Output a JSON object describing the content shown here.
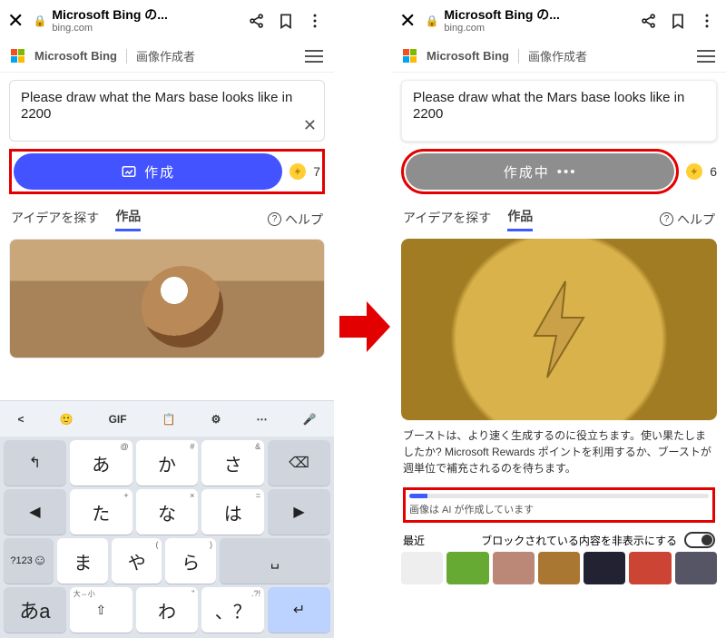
{
  "browser": {
    "title": "Microsoft Bing の...",
    "domain": "bing.com"
  },
  "bing": {
    "brand": "Microsoft Bing",
    "subtitle": "画像作成者"
  },
  "prompt": {
    "text": "Please draw what the Mars base looks like in 2200"
  },
  "tabs": {
    "explore": "アイデアを探す",
    "works": "作品",
    "help": "ヘルプ"
  },
  "left": {
    "create_label": "作成",
    "boost_count": "7"
  },
  "right": {
    "creating_label": "作成中",
    "boost_count": "6",
    "info_text": "ブーストは、より速く生成するのに役立ちます。使い果たしましたか? Microsoft Rewards ポイントを利用するか、ブーストが週単位で補充されるのを待ちます。",
    "progress_label": "画像は AI が作成しています",
    "recent_label": "最近",
    "recent_toggle_label": "ブロックされている内容を非表示にする"
  },
  "keyboard": {
    "toolbar": [
      "<",
      "☺",
      "GIF",
      "📋",
      "⚙",
      "…",
      "🎤"
    ],
    "rows": [
      [
        {
          "c": "↰",
          "fn": true
        },
        {
          "c": "あ",
          "sup": "@"
        },
        {
          "c": "か",
          "sup": "#"
        },
        {
          "c": "さ",
          "sup": "&"
        },
        {
          "c": "⌫",
          "fn": true
        }
      ],
      [
        {
          "c": "◀",
          "fn": true
        },
        {
          "c": "た",
          "sup": "+"
        },
        {
          "c": "な",
          "sup": "×"
        },
        {
          "c": "は",
          "sup": "="
        },
        {
          "c": "▶",
          "fn": true
        }
      ],
      [
        {
          "c": "☺",
          "fn": true,
          "side": "?123"
        },
        {
          "c": "ま",
          "sup": ""
        },
        {
          "c": "や",
          "sup": "("
        },
        {
          "c": "ら",
          "sup": ")"
        },
        {
          "c": "␣",
          "fn": true,
          "sp": true
        }
      ],
      [
        {
          "c": "あa",
          "fn": true,
          "ak": true
        },
        {
          "c": "⇧",
          "sup": "大⇔小",
          "tiny": true
        },
        {
          "c": "わ",
          "sup": "\""
        },
        {
          "c": "、？",
          "sup": ".?!"
        },
        {
          "c": "↵",
          "fn": true,
          "ent": true
        }
      ]
    ],
    "side_label": "?123"
  }
}
